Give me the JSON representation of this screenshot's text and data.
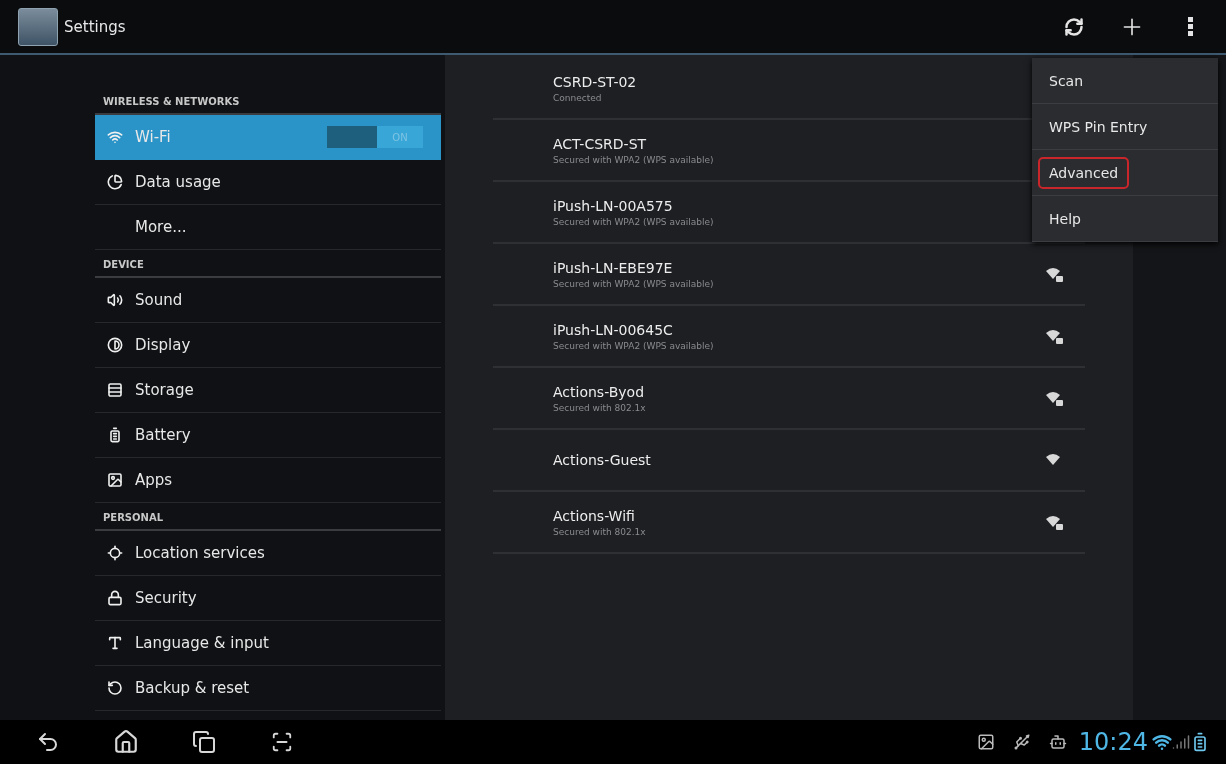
{
  "app_bar": {
    "title": "Settings",
    "actions": [
      {
        "kind": "wps"
      },
      {
        "kind": "add"
      },
      {
        "kind": "overflow"
      }
    ]
  },
  "sidebar": {
    "items": [
      {
        "kind": "header",
        "label": "WIRELESS & NETWORKS"
      },
      {
        "kind": "item",
        "label": "Wi-Fi",
        "selected": true,
        "toggle": {
          "on": true,
          "label": "ON"
        }
      },
      {
        "kind": "item",
        "label": "Data usage",
        "selected": false
      },
      {
        "kind": "item",
        "label": "More...",
        "selected": false
      },
      {
        "kind": "header",
        "label": "DEVICE"
      },
      {
        "kind": "item",
        "label": "Sound",
        "selected": false
      },
      {
        "kind": "item",
        "label": "Display",
        "selected": false
      },
      {
        "kind": "item",
        "label": "Storage",
        "selected": false
      },
      {
        "kind": "item",
        "label": "Battery",
        "selected": false
      },
      {
        "kind": "item",
        "label": "Apps",
        "selected": false
      },
      {
        "kind": "header",
        "label": "PERSONAL"
      },
      {
        "kind": "item",
        "label": "Location services",
        "selected": false
      },
      {
        "kind": "item",
        "label": "Security",
        "selected": false
      },
      {
        "kind": "item",
        "label": "Language & input",
        "selected": false
      },
      {
        "kind": "item",
        "label": "Backup & reset",
        "selected": false
      }
    ]
  },
  "networks": [
    {
      "name": "CSRD-ST-02",
      "status": "Connected"
    },
    {
      "name": "ACT-CSRD-ST",
      "status": "Secured with WPA2 (WPS available)"
    },
    {
      "name": "iPush-LN-00A575",
      "status": "Secured with WPA2 (WPS available)"
    },
    {
      "name": "iPush-LN-EBE97E",
      "status": "Secured with WPA2 (WPS available)",
      "secured": true
    },
    {
      "name": "iPush-LN-00645C",
      "status": "Secured with WPA2 (WPS available)",
      "secured": true
    },
    {
      "name": "Actions-Byod",
      "status": "Secured with 802.1x",
      "secured": true
    },
    {
      "name": "Actions-Guest",
      "secured": false
    },
    {
      "name": "Actions-Wifi",
      "status": "Secured with 802.1x",
      "secured": true
    }
  ],
  "menu": {
    "items": [
      {
        "label": "Scan",
        "highlighted": false
      },
      {
        "label": "WPS Pin Entry",
        "highlighted": false
      },
      {
        "label": "Advanced",
        "highlighted": true
      },
      {
        "label": "Help",
        "highlighted": false
      }
    ]
  },
  "system_bar": {
    "nav": [
      {
        "kind": "back"
      },
      {
        "kind": "home"
      },
      {
        "kind": "recents"
      },
      {
        "kind": "screenshot"
      }
    ],
    "notifications": [
      {
        "kind": "gallery"
      },
      {
        "kind": "usb"
      },
      {
        "kind": "android"
      }
    ],
    "time": "10:24",
    "indicators": [
      {
        "kind": "wifi"
      },
      {
        "kind": "signal"
      },
      {
        "kind": "battery"
      }
    ]
  }
}
